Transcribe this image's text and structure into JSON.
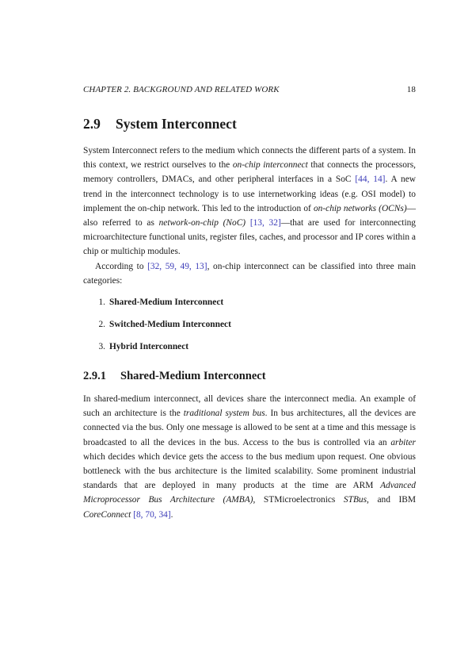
{
  "header": {
    "chapter": "CHAPTER 2.  BACKGROUND AND RELATED WORK",
    "page_number": "18"
  },
  "section": {
    "number": "2.9",
    "title": "System Interconnect"
  },
  "para1": {
    "s1": "System Interconnect refers to the medium which connects the different parts of a system. In this context, we restrict ourselves to the ",
    "em1": "on-chip interconnect",
    "s2": " that connects the processors, memory controllers, DMACs, and other peripheral interfaces in a SoC ",
    "cite1": "[44, 14]",
    "s3": ". A new trend in the interconnect technology is to use internetworking ideas (e.g. OSI model) to implement the on-chip network. This led to the introduction of ",
    "em2": "on-chip networks (OCNs)",
    "s4": "—also referred to as ",
    "em3": "network-on-chip (NoC)",
    "s5": " ",
    "cite2": "[13, 32]",
    "s6": "—that are used for interconnecting microarchitecture functional units, register files, caches, and processor and IP cores within a chip or multichip modules."
  },
  "para2": {
    "s1": "According to ",
    "cite1": "[32, 59, 49, 13]",
    "s2": ", on-chip interconnect can be classified into three main categories:"
  },
  "list": [
    {
      "num": "1.",
      "text": "Shared-Medium Interconnect"
    },
    {
      "num": "2.",
      "text": "Switched-Medium Interconnect"
    },
    {
      "num": "3.",
      "text": "Hybrid Interconnect"
    }
  ],
  "subsection": {
    "number": "2.9.1",
    "title": "Shared-Medium Interconnect"
  },
  "para3": {
    "s1": "In shared-medium interconnect, all devices share the interconnect media. An example of such an architecture is the ",
    "em1": "traditional system bus",
    "s2": ". In bus architectures, all the devices are connected via the bus. Only one message is allowed to be sent at a time and this message is broadcasted to all the devices in the bus. Access to the bus is controlled via an ",
    "em2": "arbiter",
    "s3": " which decides which device gets the access to the bus medium upon request. One obvious bottleneck with the bus architecture is the limited scalability. Some prominent industrial standards that are deployed in many products at the time are ARM ",
    "em3": "Advanced Microprocessor Bus Architecture (AMBA)",
    "s4": ", STMicroelectronics ",
    "em4": "STBus",
    "s5": ", and IBM ",
    "em5": "CoreConnect",
    "s6": " ",
    "cite1": "[8, 70, 34]",
    "s7": "."
  },
  "colors": {
    "citation": "#3b3bb8",
    "text": "#1a1a1a"
  }
}
